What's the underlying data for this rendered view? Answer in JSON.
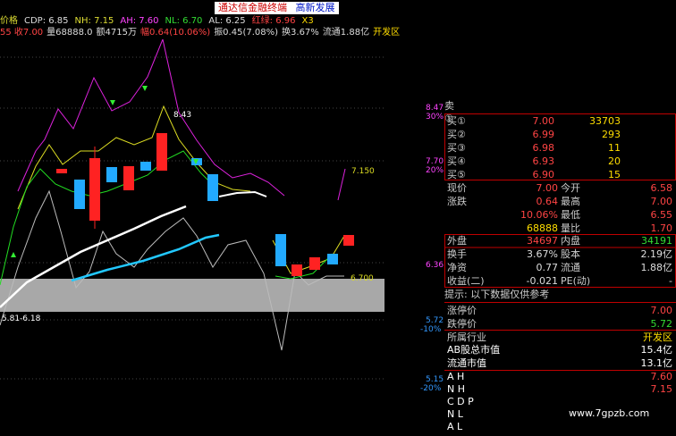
{
  "title_bar": {
    "title": "通达信金融终端",
    "subtitle": "高新发展"
  },
  "legend": [
    {
      "text": "价格",
      "color": "#dddd33"
    },
    {
      "text": "CDP: 6.85",
      "color": "#dddddd"
    },
    {
      "text": "NH: 7.15",
      "color": "#dddd33"
    },
    {
      "text": "AH: 7.60",
      "color": "#ff44ff"
    },
    {
      "text": "NL: 6.70",
      "color": "#33dd33"
    },
    {
      "text": "AL: 6.25",
      "color": "#dddddd"
    },
    {
      "text": "红绿: 6.96",
      "color": "#ff4444"
    },
    {
      "text": "X3",
      "color": "#ffdd00"
    }
  ],
  "info_line": [
    {
      "text": "55 收7.00",
      "color": "#ff4444"
    },
    {
      "text": "量68888.0",
      "color": "#dddddd"
    },
    {
      "text": "额4715万",
      "color": "#dddddd"
    },
    {
      "text": "幅0.64(10.06%)",
      "color": "#ff4444"
    },
    {
      "text": "振0.45(7.08%)",
      "color": "#dddddd"
    },
    {
      "text": "换3.67%",
      "color": "#dddddd"
    },
    {
      "text": "流通1.88亿",
      "color": "#dddddd"
    },
    {
      "text": "开发区",
      "color": "#ffdd00"
    }
  ],
  "chart": {
    "price_labels": [
      {
        "text": "8.47",
        "color": "#ff44ff"
      },
      {
        "text": "30%",
        "color": "#ff44ff"
      },
      {
        "text": "7.70",
        "color": "#ff44ff"
      },
      {
        "text": "20%",
        "color": "#ff44ff"
      },
      {
        "text": "6.36",
        "color": "#ff44ff"
      },
      {
        "text": "5.72",
        "color": "#3399ff"
      },
      {
        "text": "-10%",
        "color": "#3399ff"
      },
      {
        "text": "5.15",
        "color": "#3399ff"
      },
      {
        "text": "-20%",
        "color": "#3399ff"
      }
    ],
    "annotations": {
      "peak": "8.43",
      "right_value": "7.150",
      "nl_value": "6.700",
      "range": "5.81-6.18"
    }
  },
  "quote": {
    "sell_header": "卖①",
    "asks": [
      {
        "label": "买①",
        "price": "7.00",
        "vol": "33703"
      },
      {
        "label": "买②",
        "price": "6.99",
        "vol": "293"
      },
      {
        "label": "买③",
        "price": "6.98",
        "vol": "11"
      },
      {
        "label": "买④",
        "price": "6.93",
        "vol": "20"
      },
      {
        "label": "买⑤",
        "price": "6.90",
        "vol": "15"
      }
    ],
    "stats": [
      {
        "l1": "现价",
        "v1": "7.00",
        "l2": "今开",
        "v2": "6.58",
        "c1": "#ff4444",
        "c2": "#ff4444"
      },
      {
        "l1": "涨跌",
        "v1": "0.64",
        "l2": "最高",
        "v2": "7.00",
        "c1": "#ff4444",
        "c2": "#ff4444"
      },
      {
        "l1": "",
        "v1": "10.06%",
        "l2": "最低",
        "v2": "6.55",
        "c1": "#ff4444",
        "c2": "#ff4444"
      },
      {
        "l1": "",
        "v1": "68888",
        "l2": "量比",
        "v2": "1.70",
        "c1": "#ffdd00",
        "c2": "#ff4444"
      }
    ],
    "trade": [
      {
        "l1": "外盘",
        "v1": "34697",
        "l2": "内盘",
        "v2": "34191",
        "c1": "#ff4444",
        "c2": "#33dd33"
      },
      {
        "l1": "换手",
        "v1": "3.67%",
        "l2": "股本",
        "v2": "2.19亿",
        "c1": "#dddddd",
        "c2": "#dddddd"
      },
      {
        "l1": "净资",
        "v1": "0.77",
        "l2": "流通",
        "v2": "1.88亿",
        "c1": "#dddddd",
        "c2": "#dddddd"
      },
      {
        "l1": "收益(二)",
        "v1": "-0.021",
        "l2": "PE(动)",
        "v2": "-",
        "c1": "#dddddd",
        "c2": "#dddddd"
      }
    ],
    "notice": "提示: 以下数据仅供参考",
    "limits": [
      {
        "label": "涨停价",
        "value": "7.00",
        "color": "#ff4444"
      },
      {
        "label": "跌停价",
        "value": "5.72",
        "color": "#33dd33"
      }
    ],
    "industry": {
      "label": "所属行业",
      "value": "开发区"
    },
    "market": [
      {
        "label": "AB股总市值",
        "value": "15.4亿"
      },
      {
        "label": "流通市值",
        "value": "13.1亿"
      }
    ],
    "indicators": [
      {
        "label": "A H",
        "value": "7.60",
        "color": "#ff4444"
      },
      {
        "label": "N H",
        "value": "7.15",
        "color": "#ff4444"
      },
      {
        "label": "C D P",
        "value": ""
      },
      {
        "label": "N L",
        "value": ""
      },
      {
        "label": "A L",
        "value": ""
      }
    ]
  },
  "watermark": "www.7gpzb.com",
  "colors": {
    "up": "#ff3333",
    "down": "#00ccff",
    "border": "#c00000"
  }
}
